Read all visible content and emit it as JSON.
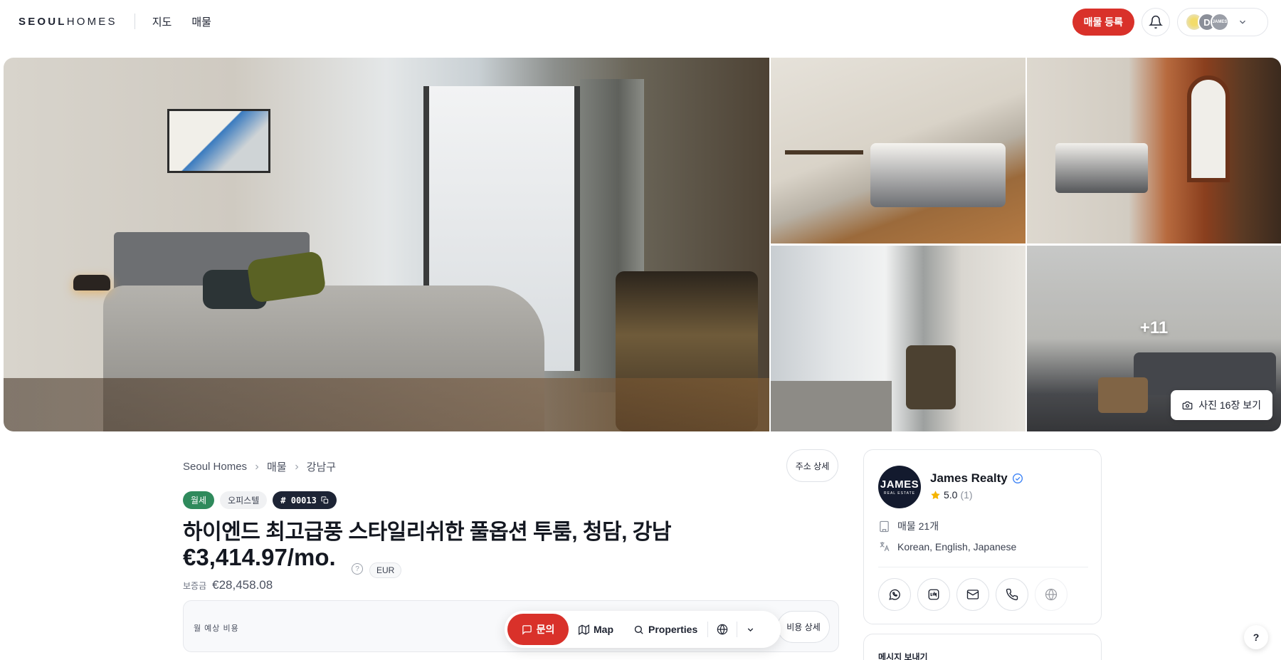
{
  "header": {
    "logo_bold": "SEOUL",
    "logo_thin": "HOMES",
    "nav": [
      "지도",
      "매물"
    ],
    "register_button": "매물 등록",
    "avatars": [
      "",
      "D",
      "JAMES"
    ]
  },
  "gallery": {
    "more_count": "+11",
    "view_photos_label": "사진 16장 보기"
  },
  "breadcrumb": [
    "Seoul Homes",
    "매물",
    "강남구"
  ],
  "address_detail_button": "주소 상세",
  "listing": {
    "tags": [
      "월세",
      "오피스텔"
    ],
    "id": "# 00013",
    "title": "하이엔드 최고급풍 스타일리쉬한 풀옵션 투룸, 청담, 강남",
    "price": "€3,414.97/mo.",
    "currency": "EUR",
    "deposit_label": "보증금",
    "deposit_value": "€28,458.08",
    "monthly_cost_label": "월 예상 비용",
    "cost_detail_button": "비용 상세"
  },
  "floatbar": {
    "inquiry": "문의",
    "map": "Map",
    "properties": "Properties"
  },
  "agent": {
    "logo_text": "JAMES",
    "logo_subtext": "REAL ESTATE",
    "name": "James Realty",
    "rating": "5.0",
    "rating_count": "(1)",
    "listings": "매물 21개",
    "languages": "Korean, English, Japanese"
  },
  "message_card_title": "메시지 보내기",
  "help_label": "?",
  "colors": {
    "accent_red": "#d9312a",
    "tag_green": "#2f8a5c",
    "id_dark": "#1d2435",
    "verified_blue": "#3b82f6",
    "star": "#f5b400"
  }
}
